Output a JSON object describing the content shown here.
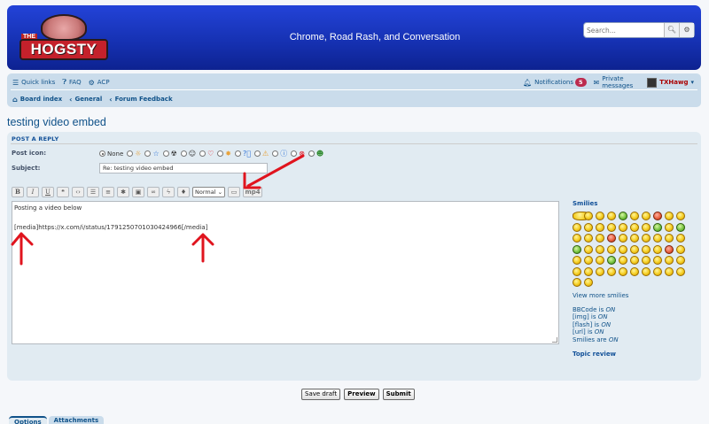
{
  "header": {
    "brand_small": "THE",
    "brand": "HOGSTY",
    "tagline": "Chrome, Road Rash, and Conversation",
    "search_placeholder": "Search..."
  },
  "nav": {
    "quick_links": "Quick links",
    "faq": "FAQ",
    "acp": "ACP",
    "notifications": "Notifications",
    "notifications_count": "5",
    "private_messages": "Private messages",
    "username": "TXHawg",
    "breadcrumbs": [
      "Board index",
      "General",
      "Forum Feedback"
    ]
  },
  "topic_title": "testing video embed",
  "form": {
    "section_title": "POST A REPLY",
    "post_icon_label": "Post icon:",
    "post_icon_none": "None",
    "subject_label": "Subject:",
    "subject_value": "Re: testing video embed",
    "font_size": "Normal",
    "mp4_label": "mp4",
    "message_line1": "Posting a video below",
    "message_line2": "[media]https://x.com/i/status/1791250701030424966[/media]"
  },
  "sidebar": {
    "smilies_title": "Smilies",
    "view_more": "View more smilies",
    "bbcode": {
      "prefix": "BBCode",
      "is": "is",
      "value": "ON"
    },
    "img": {
      "prefix": "[img]",
      "is": "is",
      "value": "ON"
    },
    "flash": {
      "prefix": "[flash]",
      "is": "is",
      "value": "ON"
    },
    "url": {
      "prefix": "[url]",
      "is": "is",
      "value": "ON"
    },
    "smilies_status": {
      "prefix": "Smilies are",
      "value": "ON"
    },
    "topic_review": "Topic review"
  },
  "buttons": {
    "save_draft": "Save draft",
    "preview": "Preview",
    "submit": "Submit"
  },
  "tabs": [
    "Options",
    "Attachments"
  ],
  "colors": {
    "header_blue": "#1530b0",
    "link": "#105289",
    "panel": "#e1ebf2",
    "annotation_red": "#e0141e"
  }
}
